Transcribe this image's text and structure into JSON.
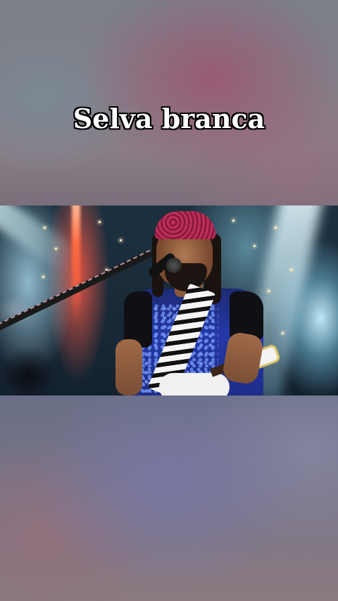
{
  "caption": {
    "title": "Selva branca"
  },
  "video": {
    "scene": "live-concert"
  },
  "colors": {
    "caption_text": "#ffffff",
    "caption_outline": "#000000",
    "background_blur": "#7a7686"
  }
}
